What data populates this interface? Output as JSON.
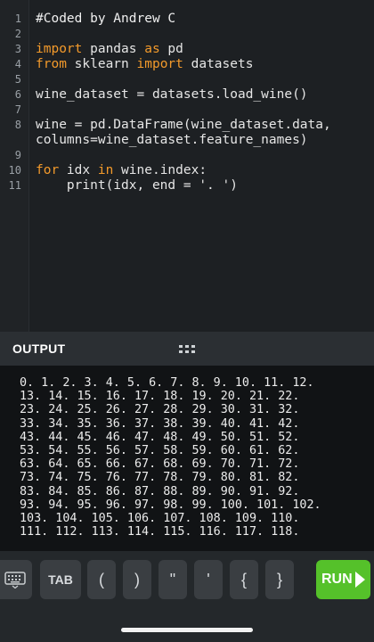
{
  "editor": {
    "line_numbers": [
      "1",
      "2",
      "3",
      "4",
      "5",
      "6",
      "7",
      "8",
      "9",
      "10",
      "11"
    ],
    "lines": [
      {
        "parts": [
          {
            "t": "#Coded by Andrew C",
            "c": "cm"
          }
        ]
      },
      {
        "parts": []
      },
      {
        "parts": [
          {
            "t": "import",
            "c": "kw"
          },
          {
            "t": " pandas ",
            "c": ""
          },
          {
            "t": "as",
            "c": "kw"
          },
          {
            "t": " pd",
            "c": ""
          }
        ]
      },
      {
        "parts": [
          {
            "t": "from",
            "c": "kw"
          },
          {
            "t": " sklearn ",
            "c": ""
          },
          {
            "t": "import",
            "c": "kw"
          },
          {
            "t": " datasets",
            "c": ""
          }
        ]
      },
      {
        "parts": []
      },
      {
        "parts": [
          {
            "t": "wine_dataset = datasets.load_wine()",
            "c": ""
          }
        ]
      },
      {
        "parts": []
      },
      {
        "parts": [
          {
            "t": "wine = pd.DataFrame(wine_dataset.data,",
            "c": ""
          }
        ]
      },
      {
        "parts": [
          {
            "t": "columns=wine_dataset.feature_names)",
            "c": ""
          }
        ]
      },
      {
        "parts": []
      },
      {
        "parts": [
          {
            "t": "for",
            "c": "kw"
          },
          {
            "t": " idx ",
            "c": ""
          },
          {
            "t": "in",
            "c": "kw"
          },
          {
            "t": " wine.index:",
            "c": ""
          }
        ]
      },
      {
        "parts": [
          {
            "t": "    print(idx, end = '. ')",
            "c": ""
          }
        ]
      }
    ]
  },
  "output": {
    "title": "OUTPUT",
    "lines": [
      "0. 1. 2. 3. 4. 5. 6. 7. 8. 9. 10. 11. 12.",
      "13. 14. 15. 16. 17. 18. 19. 20. 21. 22.",
      "23. 24. 25. 26. 27. 28. 29. 30. 31. 32.",
      "33. 34. 35. 36. 37. 38. 39. 40. 41. 42.",
      "43. 44. 45. 46. 47. 48. 49. 50. 51. 52.",
      "53. 54. 55. 56. 57. 58. 59. 60. 61. 62.",
      "63. 64. 65. 66. 67. 68. 69. 70. 71. 72.",
      "73. 74. 75. 76. 77. 78. 79. 80. 81. 82.",
      "83. 84. 85. 86. 87. 88. 89. 90. 91. 92.",
      "93. 94. 95. 96. 97. 98. 99. 100. 101. 102.",
      "103. 104. 105. 106. 107. 108. 109. 110.",
      "111. 112. 113. 114. 115. 116. 117. 118."
    ]
  },
  "toolbar": {
    "keyboard_icon": "keyboard-icon",
    "keys": [
      "TAB",
      "(",
      ")",
      "\"",
      "'",
      "{",
      "}"
    ],
    "run_label": "RUN",
    "run_icon": "play-arrow-icon"
  },
  "colors": {
    "keyword": "#f39a2b",
    "run": "#55c12a"
  }
}
